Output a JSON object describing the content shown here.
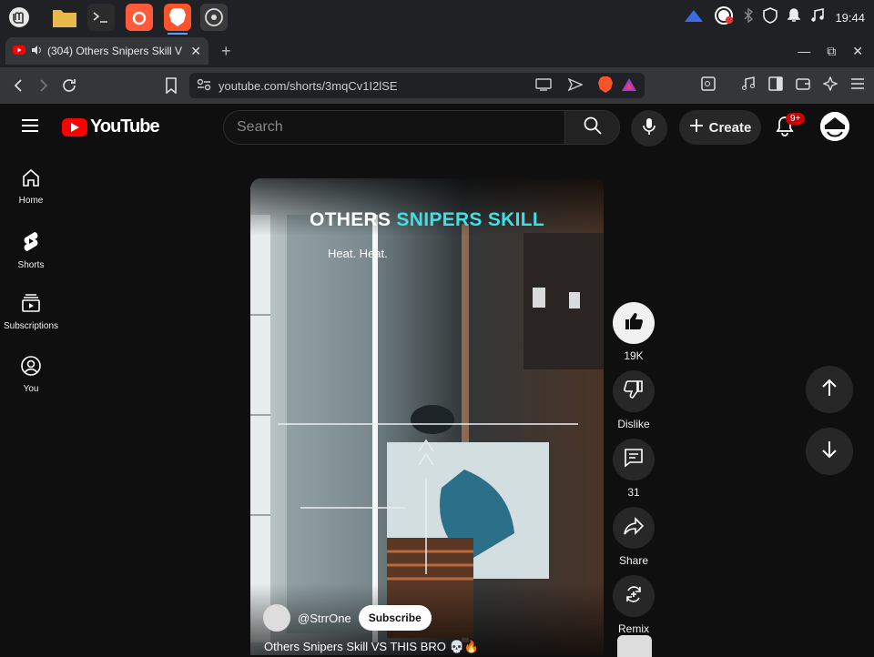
{
  "taskbar": {
    "apps": [
      {
        "name": "mint-menu-icon",
        "color": "#e8e8e8"
      },
      {
        "name": "folder-icon",
        "color": "#e8b84a"
      },
      {
        "name": "terminal-icon",
        "color": "#2b2b2b"
      },
      {
        "name": "app-icon",
        "color": "#ff5a3c"
      },
      {
        "name": "brave-icon",
        "color": "#fb542b"
      },
      {
        "name": "obs-icon",
        "color": "#3a3a3a"
      }
    ],
    "clock": "19:44"
  },
  "tab": {
    "title": "(304) Others Snipers Skill V"
  },
  "toolbar": {
    "url": "youtube.com/shorts/3mqCv1I2lSE"
  },
  "header": {
    "logo_text": "YouTube",
    "search_placeholder": "Search",
    "create_label": "Create",
    "notifications_badge": "9+"
  },
  "sidebar": {
    "items": [
      {
        "label": "Home"
      },
      {
        "label": "Shorts"
      },
      {
        "label": "Subscriptions"
      },
      {
        "label": "You"
      }
    ]
  },
  "video": {
    "title_part1": "OTHERS ",
    "title_part2": "SNIPERS SKILL",
    "caption": "Heat. Heat.",
    "channel": "@StrrOne",
    "subscribe_label": "Subscribe",
    "short_title": "Others Snipers Skill VS THIS BRO 💀🔥"
  },
  "actions": {
    "like_count": "19K",
    "dislike_label": "Dislike",
    "comments_count": "31",
    "share_label": "Share",
    "remix_label": "Remix"
  },
  "colors": {
    "accent": "#ff0000",
    "title_cyan": "#3ee0e6"
  }
}
